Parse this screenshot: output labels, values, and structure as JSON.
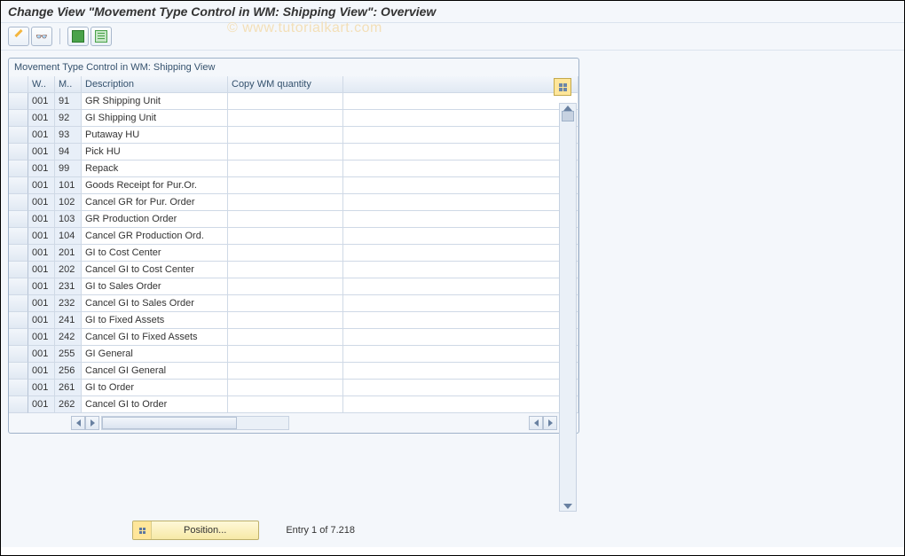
{
  "title": "Change View \"Movement Type Control in WM: Shipping View\": Overview",
  "panel_title": "Movement Type Control in WM: Shipping View",
  "watermark": "© www.tutorialkart.com",
  "columns": {
    "sel": "",
    "w": "W..",
    "m": "M..",
    "desc": "Description",
    "copy": "Copy WM quantity"
  },
  "rows": [
    {
      "w": "001",
      "m": "91",
      "desc": "GR Shipping Unit",
      "copy": ""
    },
    {
      "w": "001",
      "m": "92",
      "desc": "GI Shipping Unit",
      "copy": ""
    },
    {
      "w": "001",
      "m": "93",
      "desc": "Putaway HU",
      "copy": ""
    },
    {
      "w": "001",
      "m": "94",
      "desc": "Pick HU",
      "copy": ""
    },
    {
      "w": "001",
      "m": "99",
      "desc": "Repack",
      "copy": ""
    },
    {
      "w": "001",
      "m": "101",
      "desc": "Goods Receipt for Pur.Or.",
      "copy": ""
    },
    {
      "w": "001",
      "m": "102",
      "desc": "Cancel GR for Pur. Order",
      "copy": ""
    },
    {
      "w": "001",
      "m": "103",
      "desc": "GR Production Order",
      "copy": ""
    },
    {
      "w": "001",
      "m": "104",
      "desc": "Cancel GR Production Ord.",
      "copy": ""
    },
    {
      "w": "001",
      "m": "201",
      "desc": "GI to Cost Center",
      "copy": ""
    },
    {
      "w": "001",
      "m": "202",
      "desc": "Cancel GI to Cost Center",
      "copy": ""
    },
    {
      "w": "001",
      "m": "231",
      "desc": "GI to Sales Order",
      "copy": ""
    },
    {
      "w": "001",
      "m": "232",
      "desc": "Cancel GI to Sales Order",
      "copy": ""
    },
    {
      "w": "001",
      "m": "241",
      "desc": "GI to Fixed Assets",
      "copy": ""
    },
    {
      "w": "001",
      "m": "242",
      "desc": "Cancel GI to Fixed Assets",
      "copy": ""
    },
    {
      "w": "001",
      "m": "255",
      "desc": "GI General",
      "copy": ""
    },
    {
      "w": "001",
      "m": "256",
      "desc": "Cancel GI General",
      "copy": ""
    },
    {
      "w": "001",
      "m": "261",
      "desc": "GI to Order",
      "copy": ""
    },
    {
      "w": "001",
      "m": "262",
      "desc": "Cancel GI to Order",
      "copy": ""
    }
  ],
  "position_button": "Position...",
  "entry_text": "Entry 1 of 7.218"
}
